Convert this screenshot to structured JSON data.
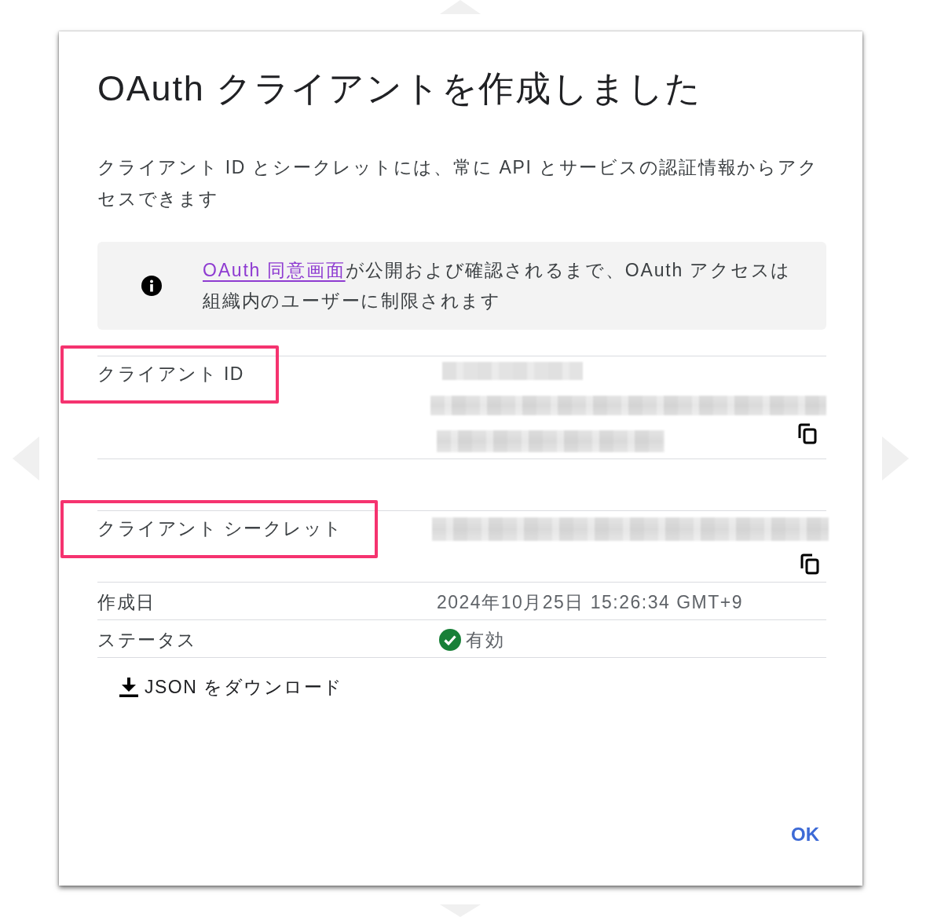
{
  "dialog": {
    "title": "OAuth クライアントを作成しました",
    "description": "クライアント ID とシークレットには、常に API とサービスの認証情報からアクセスできます",
    "notice": {
      "link": "OAuth 同意画面",
      "text": "が公開および確認されるまで、OAuth アクセスは組織内のユーザーに制限されます"
    },
    "fields": [
      {
        "label": "クライアント ID",
        "kind": "id",
        "highlighted": true,
        "copyable": true
      },
      {
        "label": "クライアント シークレット",
        "kind": "secret",
        "highlighted": true,
        "copyable": true
      },
      {
        "label": "作成日",
        "kind": "text",
        "value": "2024年10月25日 15:26:34 GMT+9",
        "highlighted": false,
        "copyable": false
      },
      {
        "label": "ステータス",
        "kind": "status",
        "value": "有効",
        "enabled": true,
        "highlighted": false,
        "copyable": false
      }
    ],
    "download_button": "JSON をダウンロード",
    "ok_button": "OK"
  }
}
